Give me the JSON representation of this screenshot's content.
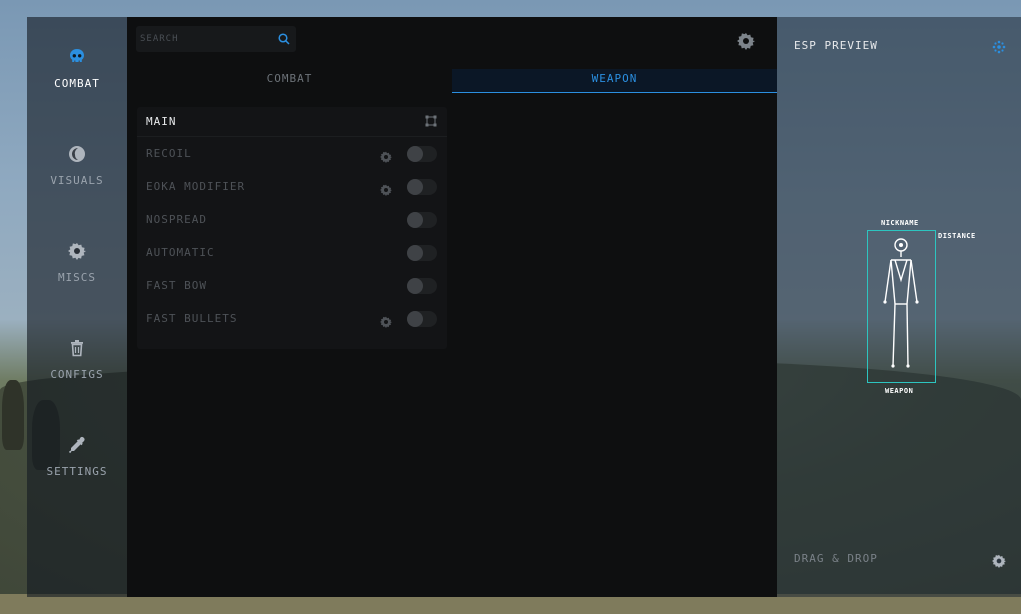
{
  "sidebar": {
    "items": [
      {
        "label": "COMBAT",
        "icon": "skull-icon",
        "active": true
      },
      {
        "label": "VISUALS",
        "icon": "moon-icon",
        "active": false
      },
      {
        "label": "MISCS",
        "icon": "gear-icon",
        "active": false
      },
      {
        "label": "CONFIGS",
        "icon": "trash-icon",
        "active": false
      },
      {
        "label": "SETTINGS",
        "icon": "pipette-icon",
        "active": false
      }
    ]
  },
  "search": {
    "placeholder": "SEARCH",
    "value": ""
  },
  "tabs": [
    {
      "label": "COMBAT",
      "active": false
    },
    {
      "label": "WEAPON",
      "active": true
    }
  ],
  "panel": {
    "title": "MAIN",
    "options": [
      {
        "label": "RECOIL",
        "has_settings": true,
        "enabled": false
      },
      {
        "label": "EOKA MODIFIER",
        "has_settings": true,
        "enabled": false
      },
      {
        "label": "NOSPREAD",
        "has_settings": false,
        "enabled": false
      },
      {
        "label": "AUTOMATIC",
        "has_settings": false,
        "enabled": false
      },
      {
        "label": "FAST BOW",
        "has_settings": false,
        "enabled": false
      },
      {
        "label": "FAST BULLETS",
        "has_settings": true,
        "enabled": false
      }
    ]
  },
  "preview": {
    "title": "ESP PREVIEW",
    "nickname": "NICKNAME",
    "distance": "DISTANCE",
    "weapon": "WEAPON",
    "drag_label": "DRAG & DROP"
  },
  "colors": {
    "accent": "#2b8fe0",
    "esp_box": "#2dc5c0",
    "panel_bg": "#131416",
    "content_bg": "#0e0f10"
  }
}
